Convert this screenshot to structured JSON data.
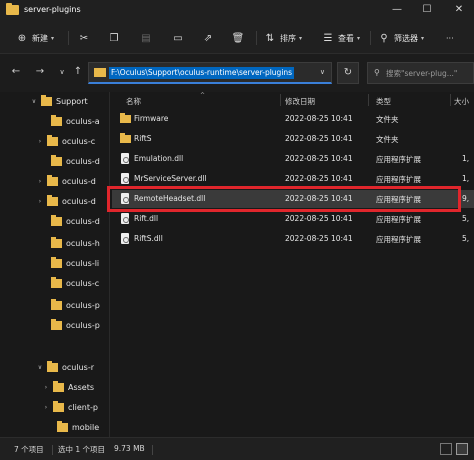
{
  "window": {
    "title": "server-plugins"
  },
  "toolbar": {
    "new_label": "新建",
    "sort_label": "排序",
    "view_label": "查看",
    "filter_label": "筛选器",
    "more_label": "···"
  },
  "address": {
    "path": "F:\\Oculus\\Support\\oculus-runtime\\server-plugins",
    "search_placeholder": "搜索\"server-plug...\""
  },
  "sidebar": {
    "items": [
      {
        "label": "Support",
        "expanded": true
      },
      {
        "label": "oculus-a"
      },
      {
        "label": "oculus-c"
      },
      {
        "label": "oculus-d"
      },
      {
        "label": "oculus-d"
      },
      {
        "label": "oculus-d"
      },
      {
        "label": "oculus-d"
      },
      {
        "label": "oculus-h"
      },
      {
        "label": "oculus-li"
      },
      {
        "label": "oculus-c"
      },
      {
        "label": "oculus-p"
      },
      {
        "label": "oculus-p"
      },
      {
        "label": "oculus-r",
        "expanded": true
      },
      {
        "label": "Assets"
      },
      {
        "label": "client-p"
      },
      {
        "label": "mobile"
      }
    ]
  },
  "columns": {
    "name": "名称",
    "date": "修改日期",
    "type": "类型",
    "size": "大小"
  },
  "files": [
    {
      "name": "Firmware",
      "date": "2022-08-25 10:41",
      "type": "文件夹",
      "size": "",
      "kind": "folder"
    },
    {
      "name": "RiftS",
      "date": "2022-08-25 10:41",
      "type": "文件夹",
      "size": "",
      "kind": "folder"
    },
    {
      "name": "Emulation.dll",
      "date": "2022-08-25 10:41",
      "type": "应用程序扩展",
      "size": "1,",
      "kind": "dll"
    },
    {
      "name": "MrServiceServer.dll",
      "date": "2022-08-25 10:41",
      "type": "应用程序扩展",
      "size": "1,",
      "kind": "dll"
    },
    {
      "name": "RemoteHeadset.dll",
      "date": "2022-08-25 10:41",
      "type": "应用程序扩展",
      "size": "9,",
      "kind": "dll",
      "selected": true
    },
    {
      "name": "Rift.dll",
      "date": "2022-08-25 10:41",
      "type": "应用程序扩展",
      "size": "5,",
      "kind": "dll"
    },
    {
      "name": "RiftS.dll",
      "date": "2022-08-25 10:41",
      "type": "应用程序扩展",
      "size": "5,",
      "kind": "dll"
    }
  ],
  "status": {
    "count": "7 个项目",
    "selected": "选中 1 个项目",
    "size": "9.73 MB"
  },
  "colors": {
    "highlight_border": "#e0262c",
    "folder": "#e8b84a",
    "accent": "#0067c0"
  }
}
